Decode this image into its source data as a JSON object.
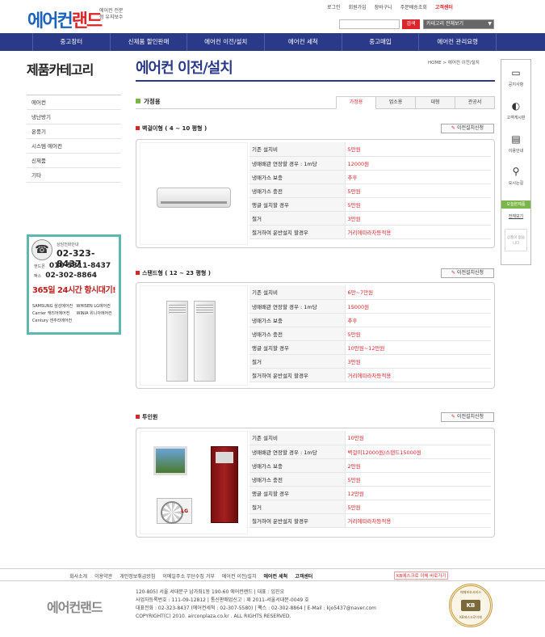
{
  "header": {
    "logo_main": "에어컨",
    "logo_accent": "랜드",
    "logo_sub": "에어컨 전문점 유지보수",
    "top_links": [
      "로그인",
      "회원가입",
      "장바구니",
      "주문배송조회",
      "고객센터"
    ],
    "search_button": "검색",
    "category_select": "카테고리 전체보기"
  },
  "nav": [
    "중고장터",
    "신제품 할인판매",
    "에어컨 이전/설치",
    "에어컨 세척",
    "중고매입",
    "에어컨 관리요령"
  ],
  "sidebar": {
    "title": "제품카테고리",
    "items": [
      "에어컨",
      "냉난방기",
      "온풍기",
      "시스템 에어컨",
      "신제품",
      "기타"
    ],
    "cs": {
      "label": "상담전화안내",
      "phone": "02-323-8437",
      "mobile_label": "핸드폰",
      "mobile": "010-5311-8437",
      "fax_label": "팩스",
      "fax": "02-302-8864",
      "always": "365일 24시간 항시대기!",
      "brands": [
        "SAMSUNG 삼성에어컨",
        "WHISEN LG에어컨",
        "Carrier 캐리어에어컨",
        "WINIA 위니아에어컨",
        "Century 센추리에어컨"
      ]
    }
  },
  "main": {
    "title": "에어컨 이전/설치",
    "breadcrumb": "HOME > 에어컨 이전/설치",
    "section": "가정용",
    "tabs": [
      "가정용",
      "업소용",
      "대형",
      "관공서"
    ],
    "request_button": "이전설치신청"
  },
  "products": [
    {
      "name": "벽걸이형 ( 4 ~ 10 평형 )",
      "rows": [
        [
          "기존 설치비",
          "5만원"
        ],
        [
          "냉매배관 연장할 경우 : 1m당",
          "12000원"
        ],
        [
          "냉매가스 보충",
          "추후"
        ],
        [
          "냉매가스 충전",
          "5만원"
        ],
        [
          "앵글 설치할 경우",
          "5만원"
        ],
        [
          "철거",
          "3만원"
        ],
        [
          "철거하여 운반설치 할경우",
          "거리에따라차등적용"
        ]
      ]
    },
    {
      "name": "스탠드형 ( 12 ~ 23 평형 )",
      "rows": [
        [
          "기존 설치비",
          "6만~7만원"
        ],
        [
          "냉매배관 연장할 경우 : 1m당",
          "15000원"
        ],
        [
          "냉매가스 보충",
          "추후"
        ],
        [
          "냉매가스 충전",
          "5만원"
        ],
        [
          "앵글 설치할 경우",
          "10만원~12만원"
        ],
        [
          "철거",
          "3만원"
        ],
        [
          "철거하여 운반설치 할경우",
          "거리에따라차등적용"
        ]
      ]
    },
    {
      "name": "투인원",
      "rows": [
        [
          "기존 설치비",
          "10만원"
        ],
        [
          "냉매배관 연장할 경우 : 1m당",
          "벽걸이12000원/스탠드15000원"
        ],
        [
          "냉매가스 보충",
          "2만원"
        ],
        [
          "냉매가스 충전",
          "5만원"
        ],
        [
          "앵글 설치할 경우",
          "12만원"
        ],
        [
          "철거",
          "5만원"
        ],
        [
          "철거하여 운반설치 할경우",
          "거리에따라차등적용"
        ]
      ]
    }
  ],
  "quick_menu": {
    "items": [
      "공지사항",
      "고객게시판",
      "이용안내",
      "오시는길"
    ],
    "recent_label": "오늘본제품",
    "recent_more": "전체보기",
    "empty_text": "상품이 없습니다"
  },
  "footer": {
    "links": [
      "회사소개",
      "이용약관",
      "개인정보취급방침",
      "이메일주소 무단수집 거부",
      "에어컨 이전/설치",
      "에어컨 세척",
      "고객센터"
    ],
    "cta": "KB에스크로 이체 바로가기",
    "logo": "에어컨랜드",
    "info": [
      "120-805) 서울 서대문구 남가좌1동 190-60 에어컨랜드 | 대표 : 임진오",
      "사업자등록번호 : 111-09-12812 | 통신판매업신고 : 제 2011-서울서대문-0049 호",
      "대표전화 : 02-323-8437 (에어컨세척 : 02-307-5580) | 팩스 : 02-302-8864 | E-Mail : kjo5437@naver.com",
      "COPYRIGHT(C) 2010. airconplaza.co.kr . ALL RIGHTS RESERVED."
    ],
    "badge_top": "매매보호서비스",
    "badge_mid": "KB",
    "badge_bottom": "KB에스크로이체"
  },
  "colors": {
    "nav_bg": "#2a3a89",
    "accent_red": "#d8262a",
    "accent_green": "#7ab648",
    "cs_border": "#5fb8b0"
  }
}
